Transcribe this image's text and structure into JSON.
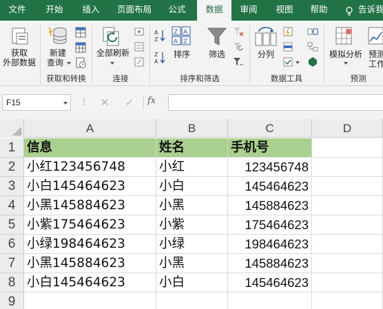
{
  "tabs": [
    {
      "label": "文件",
      "active": false
    },
    {
      "label": "开始",
      "active": false
    },
    {
      "label": "插入",
      "active": false
    },
    {
      "label": "页面布局",
      "active": false
    },
    {
      "label": "公式",
      "active": false
    },
    {
      "label": "数据",
      "active": true
    },
    {
      "label": "审阅",
      "active": false
    },
    {
      "label": "视图",
      "active": false
    },
    {
      "label": "帮助",
      "active": false
    }
  ],
  "tell_me": {
    "icon": "lightbulb-icon",
    "label": "告诉我"
  },
  "ribbon": {
    "get_external_data": {
      "line1": "获取",
      "line2": "外部数据"
    },
    "new_query": {
      "line1": "新建",
      "line2": "查询"
    },
    "group_get_transform": "获取和转换",
    "refresh_all": "全部刷新",
    "group_connections": "连接",
    "sort": "排序",
    "filter": "筛选",
    "group_sort_filter": "排序和筛选",
    "text_to_columns": "分列",
    "group_data_tools": "数据工具",
    "what_if": "模拟分析",
    "forecast": {
      "line1": "预测",
      "line2": "工作"
    },
    "group_forecast": "预测"
  },
  "formula_bar": {
    "name_box": "F15",
    "cancel_symbol": "✕",
    "enter_symbol": "✓",
    "fx_label": "fx",
    "formula": ""
  },
  "grid": {
    "columns": [
      "A",
      "B",
      "C",
      "D"
    ],
    "rows": [
      {
        "n": "1",
        "a": "信息",
        "b": "姓名",
        "c": "手机号"
      },
      {
        "n": "2",
        "a": "小红123456748",
        "b": "小红",
        "c": "123456748"
      },
      {
        "n": "3",
        "a": "小白145464623",
        "b": "小白",
        "c": "145464623"
      },
      {
        "n": "4",
        "a": "小黑145884623",
        "b": "小黑",
        "c": "145884623"
      },
      {
        "n": "5",
        "a": "小紫175464623",
        "b": "小紫",
        "c": "175464623"
      },
      {
        "n": "6",
        "a": "小绿198464623",
        "b": "小绿",
        "c": "198464623"
      },
      {
        "n": "7",
        "a": "小黑145884623",
        "b": "小黑",
        "c": "145884623"
      },
      {
        "n": "8",
        "a": "小白145464623",
        "b": "小白",
        "c": "145464623"
      },
      {
        "n": "9",
        "a": "",
        "b": "",
        "c": ""
      }
    ],
    "header_fill": "#a9d08e"
  },
  "colors": {
    "brand": "#217346",
    "ribbon_bg": "#f3f3f3"
  }
}
